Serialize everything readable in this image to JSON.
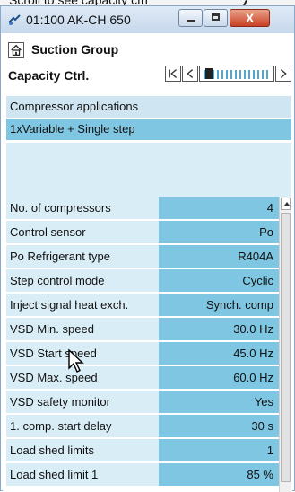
{
  "clipped_top_text": "Scroll to see capacity ctrl",
  "window": {
    "title": "01:100 AK-CH 650",
    "close_glyph": "X"
  },
  "toolbar": {
    "group_title": "Suction Group",
    "page_title": "Capacity Ctrl."
  },
  "section": {
    "label": "Compressor applications",
    "value": "1xVariable + Single step"
  },
  "rows": [
    {
      "label": "No. of compressors",
      "value": "4"
    },
    {
      "label": "Control sensor",
      "value": "Po"
    },
    {
      "label": "Po Refrigerant type",
      "value": "R404A"
    },
    {
      "label": "Step control mode",
      "value": "Cyclic"
    },
    {
      "label": "Inject signal heat exch.",
      "value": "Synch. comp"
    },
    {
      "label": "VSD Min. speed",
      "value": "30.0 Hz"
    },
    {
      "label": "VSD Start speed",
      "value": "45.0 Hz"
    },
    {
      "label": "VSD Max. speed",
      "value": "60.0 Hz"
    },
    {
      "label": "VSD safety monitor",
      "value": "Yes"
    },
    {
      "label": "1. comp. start delay",
      "value": "30 s"
    },
    {
      "label": "Load shed limits",
      "value": "1"
    },
    {
      "label": "Load shed limit 1",
      "value": "85 %"
    }
  ]
}
